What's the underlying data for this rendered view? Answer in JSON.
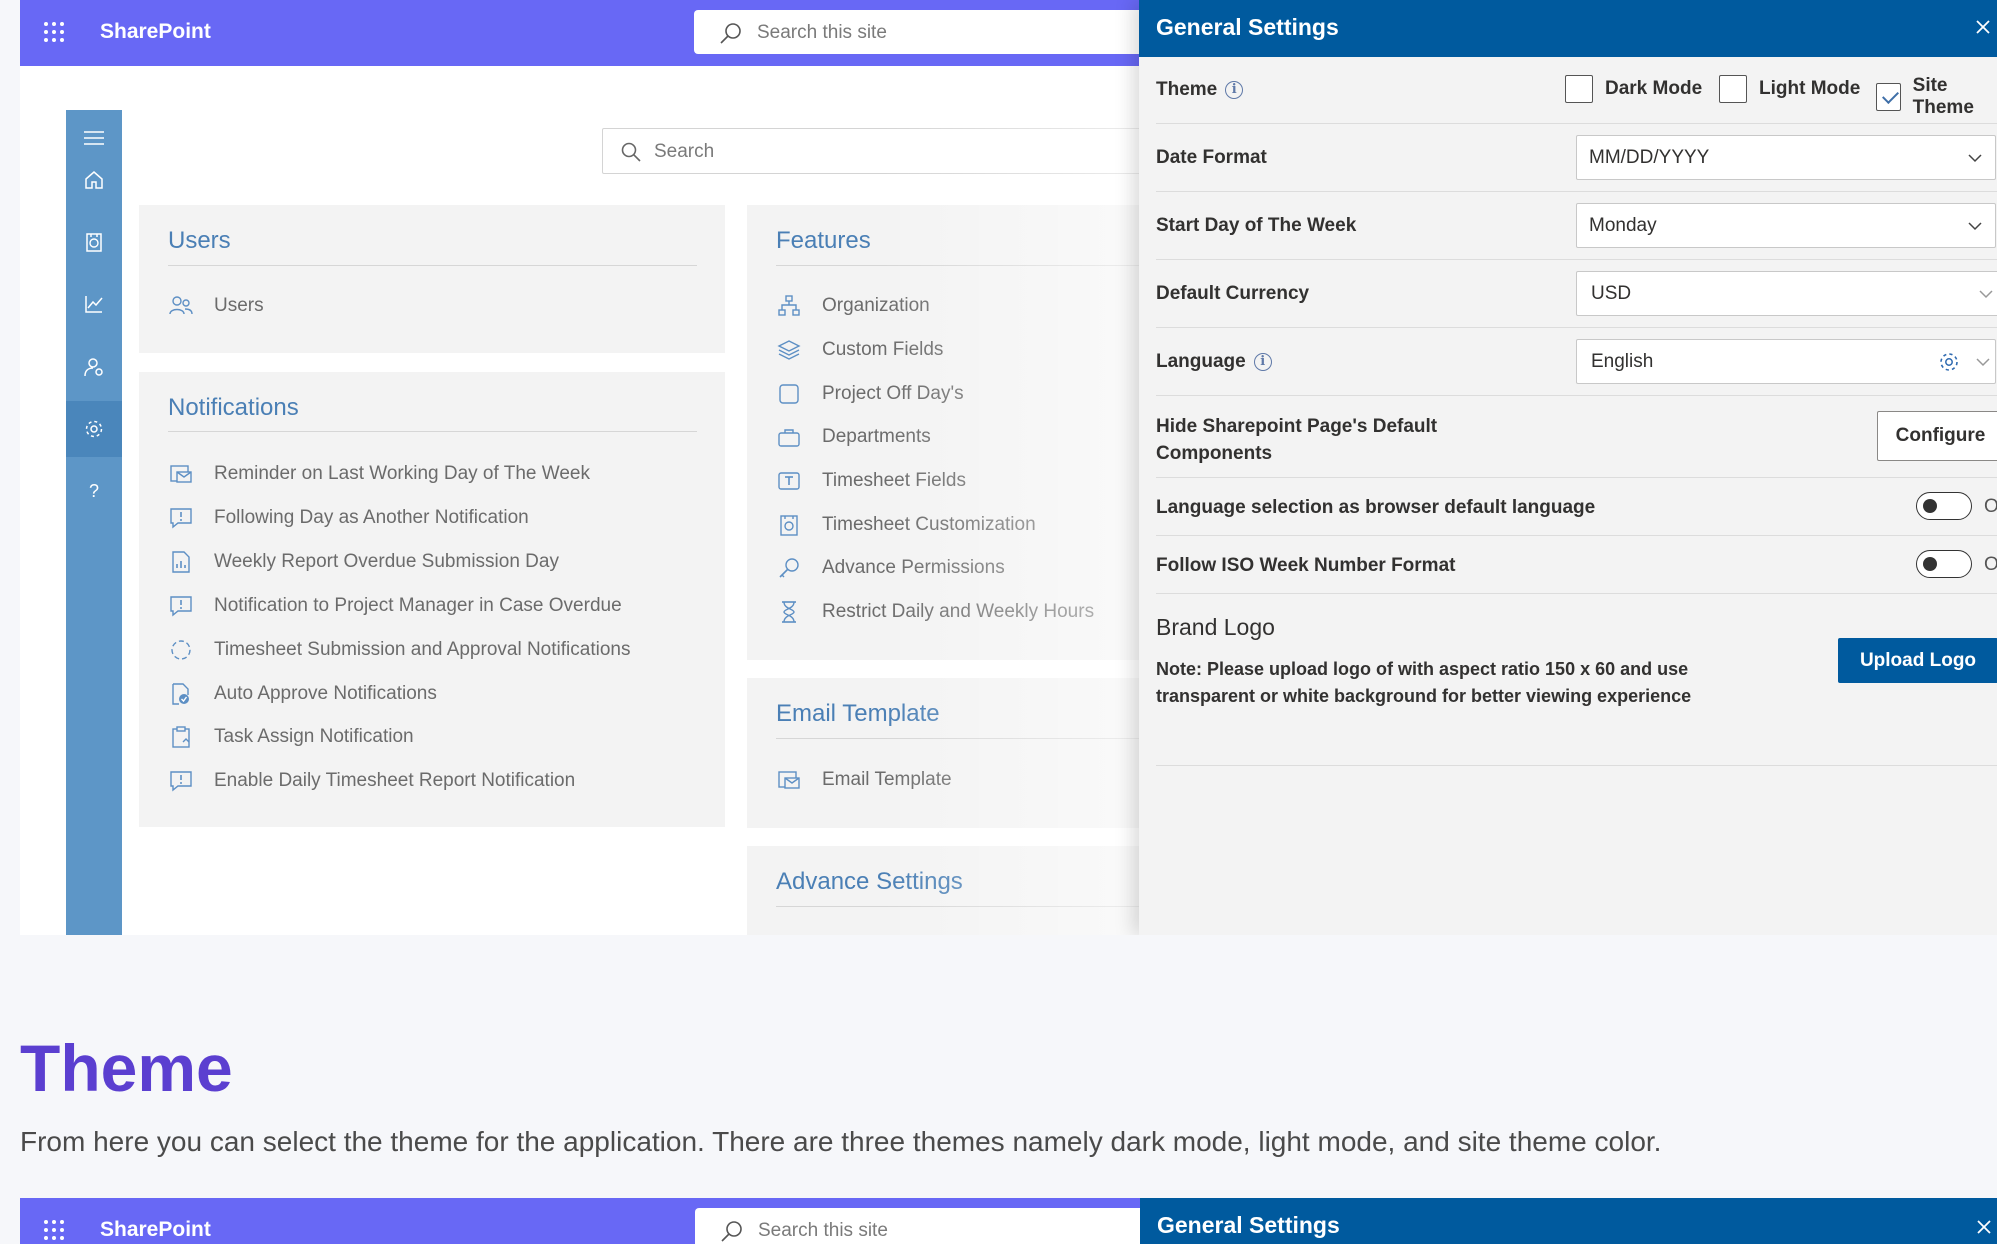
{
  "suite": {
    "brand": "SharePoint",
    "search_placeholder": "Search this site"
  },
  "content": {
    "search_placeholder": "Search"
  },
  "users_card": {
    "title": "Users",
    "items": [
      {
        "label": "Users"
      }
    ]
  },
  "notifications_card": {
    "title": "Notifications",
    "items": [
      {
        "label": "Reminder on Last Working Day of The Week"
      },
      {
        "label": "Following Day as Another Notification"
      },
      {
        "label": "Weekly Report Overdue Submission Day"
      },
      {
        "label": "Notification to Project Manager in Case Overdue"
      },
      {
        "label": "Timesheet Submission and Approval Notifications"
      },
      {
        "label": "Auto Approve Notifications"
      },
      {
        "label": "Task Assign Notification"
      },
      {
        "label": "Enable Daily Timesheet Report Notification"
      }
    ]
  },
  "features_card": {
    "title": "Features",
    "items": [
      {
        "label": "Organization"
      },
      {
        "label": "Custom Fields"
      },
      {
        "label": "Project Off Day's"
      },
      {
        "label": "Departments"
      },
      {
        "label": "Timesheet Fields"
      },
      {
        "label": "Timesheet Customization"
      },
      {
        "label": "Advance Permissions"
      },
      {
        "label": "Restrict Daily and Weekly Hours"
      }
    ]
  },
  "email_card": {
    "title": "Email Template",
    "items": [
      {
        "label": "Email Template"
      }
    ]
  },
  "advance_card": {
    "title": "Advance Settings"
  },
  "panel": {
    "title": "General Settings",
    "theme": {
      "label": "Theme",
      "options": [
        {
          "label": "Dark Mode",
          "checked": false
        },
        {
          "label": "Light Mode",
          "checked": false
        },
        {
          "label": "Site Theme",
          "checked": true
        }
      ]
    },
    "date_format": {
      "label": "Date Format",
      "value": "MM/DD/YYYY"
    },
    "start_day": {
      "label": "Start Day of The Week",
      "value": "Monday"
    },
    "currency": {
      "label": "Default Currency",
      "value": "USD"
    },
    "language": {
      "label": "Language",
      "value": "English"
    },
    "hide_components": {
      "label_line1": "Hide Sharepoint Page's Default",
      "label_line2": "Components",
      "button": "Configure"
    },
    "browser_language": {
      "label": "Language selection as browser default language",
      "state": "Off"
    },
    "iso_week": {
      "label": "Follow ISO Week Number Format",
      "state": "Off"
    },
    "brand_logo": {
      "title": "Brand Logo",
      "note_line1": "Note: Please upload logo of with aspect ratio 150 x 60 and use",
      "note_line2": "transparent or white background for better viewing experience",
      "button": "Upload Logo"
    }
  },
  "doc": {
    "title": "Theme",
    "text": "From here you can select the theme for the application. There are three themes namely dark mode, light mode, and site theme color."
  },
  "colors": {
    "suitebar": "#6868f5",
    "panel_header": "#005a9e",
    "rail": "#5d96c7",
    "heading": "#5b3fd0",
    "card_title": "#4a7fb5"
  }
}
